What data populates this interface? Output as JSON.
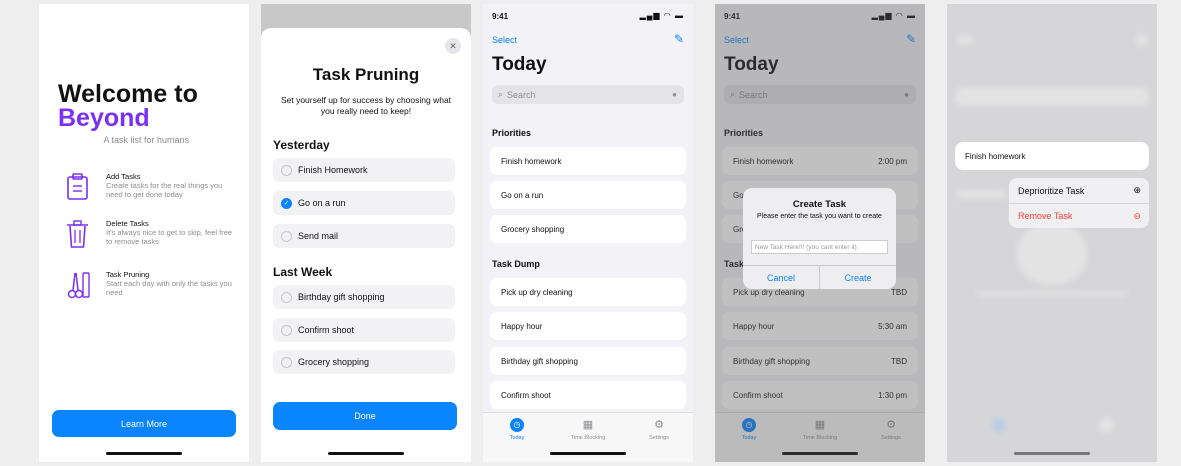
{
  "welcome": {
    "title_line1": "Welcome to",
    "title_line2": "Beyond",
    "subtitle": "A task list for humans",
    "features": [
      {
        "icon": "add-tasks-icon",
        "title": "Add Tasks",
        "desc": "Create tasks for the real things you need to get done today"
      },
      {
        "icon": "trash-icon",
        "title": "Delete Tasks",
        "desc": "It's always nice to get to skip, feel free to remove tasks"
      },
      {
        "icon": "pruning-icon",
        "title": "Task Pruning",
        "desc": "Start each day with only the tasks you need"
      }
    ],
    "button": "Learn More",
    "accent": "#7b2ff7"
  },
  "pruning": {
    "close": "✕",
    "title": "Task Pruning",
    "subtitle": "Set yourself up for success by choosing what you really need to keep!",
    "yesterday_header": "Yesterday",
    "yesterday": [
      {
        "label": "Finish Homework",
        "checked": false
      },
      {
        "label": "Go on a run",
        "checked": true
      },
      {
        "label": "Send mail",
        "checked": false
      }
    ],
    "lastweek_header": "Last Week",
    "lastweek": [
      {
        "label": "Birthday gift shopping",
        "checked": false
      },
      {
        "label": "Confirm shoot",
        "checked": false
      },
      {
        "label": "Grocery shopping",
        "checked": false
      }
    ],
    "done": "Done"
  },
  "today": {
    "time": "9:41",
    "status_icons": "▂▄▆ ◠ ▬",
    "select": "Select",
    "title": "Today",
    "search_placeholder": "Search",
    "priorities_header": "Priorities",
    "priorities": [
      {
        "label": "Finish homework",
        "time": "2:00 pm"
      },
      {
        "label": "Go on a run",
        "time": ""
      },
      {
        "label": "Grocery shopping",
        "time": ""
      }
    ],
    "dump_header": "Task Dump",
    "dump": [
      {
        "label": "Pick up dry cleaning",
        "time": "TBD"
      },
      {
        "label": "Happy hour",
        "time": "5:30 am"
      },
      {
        "label": "Birthday gift shopping",
        "time": "TBD"
      },
      {
        "label": "Confirm shoot",
        "time": "1:30 pm"
      }
    ],
    "tabs": [
      {
        "label": "Today",
        "icon": "clock-icon"
      },
      {
        "label": "Time Blocking",
        "icon": "calendar-icon"
      },
      {
        "label": "Settings",
        "icon": "gear-icon"
      }
    ],
    "accent": "#0a84ff"
  },
  "create_task": {
    "title": "Create Task",
    "message": "Please enter the task you want to create",
    "placeholder": "New Task Here!!! (you cant enter it)",
    "cancel": "Cancel",
    "create": "Create"
  },
  "context_menu": {
    "task": "Finish homework",
    "deprioritize": "Deprioritize Task",
    "remove": "Remove Task"
  }
}
